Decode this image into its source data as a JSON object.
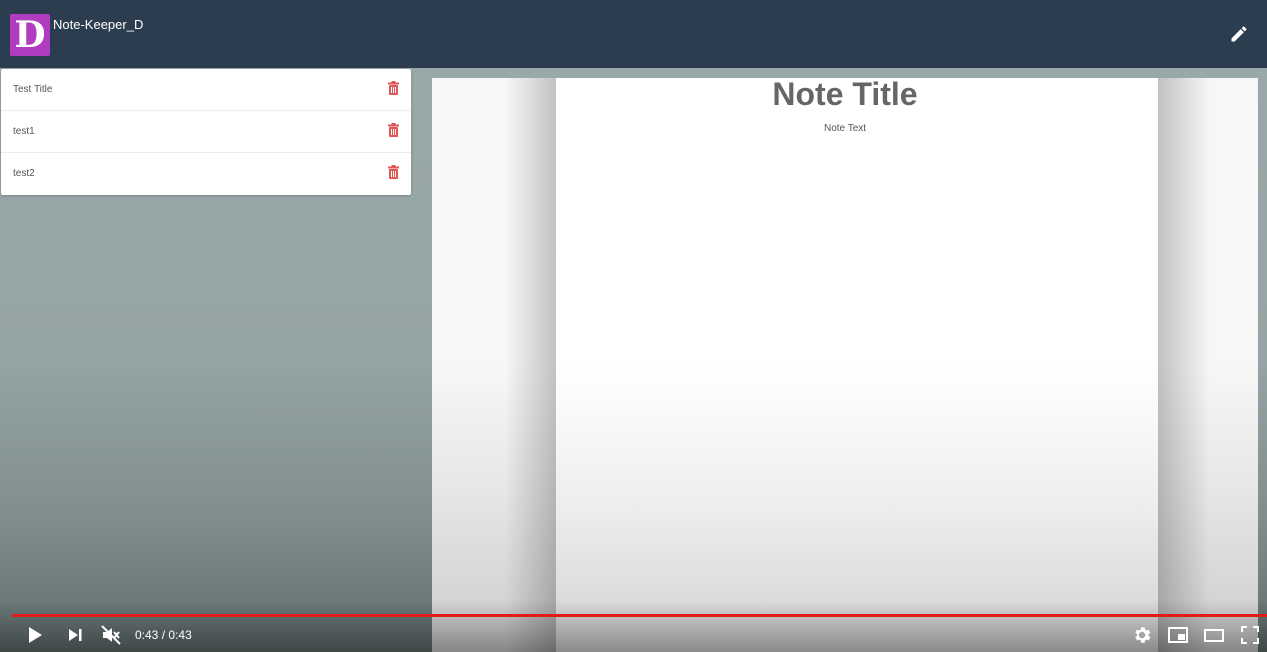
{
  "app": {
    "logo_letter": "D",
    "brand": "Note-Keeper_D",
    "logo_color": "#b03cc0",
    "navbar_color": "#2d3d50"
  },
  "notes": [
    {
      "title": "Test Title"
    },
    {
      "title": "test1"
    },
    {
      "title": "test2"
    }
  ],
  "editor": {
    "title": "Note Title",
    "text": "Note Text"
  },
  "player": {
    "current_time": "0:43",
    "separator": "/",
    "duration": "0:43",
    "progress": 1.0,
    "progress_color": "#e01b1b"
  },
  "icons": {
    "edit": "pencil-icon",
    "delete": "trash-icon",
    "play": "play-icon",
    "next": "next-icon",
    "mute": "muted-volume-icon",
    "settings": "gear-icon",
    "miniplayer": "miniplayer-icon",
    "theater": "theater-mode-icon",
    "fullscreen": "fullscreen-icon"
  }
}
